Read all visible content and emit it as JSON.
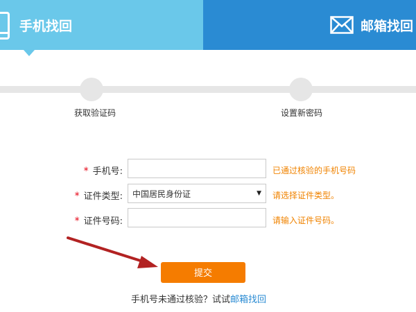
{
  "tabs": {
    "phone": {
      "label": "手机找回",
      "icon": "mobile-phone-icon"
    },
    "mail": {
      "label": "邮箱找回",
      "icon": "envelope-icon"
    }
  },
  "steps": [
    {
      "label": "获取验证码"
    },
    {
      "label": "设置新密码"
    }
  ],
  "form": {
    "required_mark": "*",
    "phone": {
      "label": "手机号:",
      "value": "",
      "placeholder": "",
      "hint": "已通过核验的手机号码"
    },
    "id_type": {
      "label": "证件类型:",
      "selected": "中国居民身份证",
      "hint": "请选择证件类型。"
    },
    "id_number": {
      "label": "证件号码:",
      "value": "",
      "placeholder": "",
      "hint": "请输入证件号码。"
    }
  },
  "submit_label": "提交",
  "footer": {
    "prefix": "手机号未通过核验？试试",
    "link": "邮箱找回"
  },
  "colors": {
    "tab_phone_bg": "#6ac8ea",
    "tab_mail_bg": "#2a8bd3",
    "submit_bg": "#f57c00",
    "hint_text": "#f08300",
    "required_star": "#e60012",
    "annotation_arrow": "#b22222"
  }
}
